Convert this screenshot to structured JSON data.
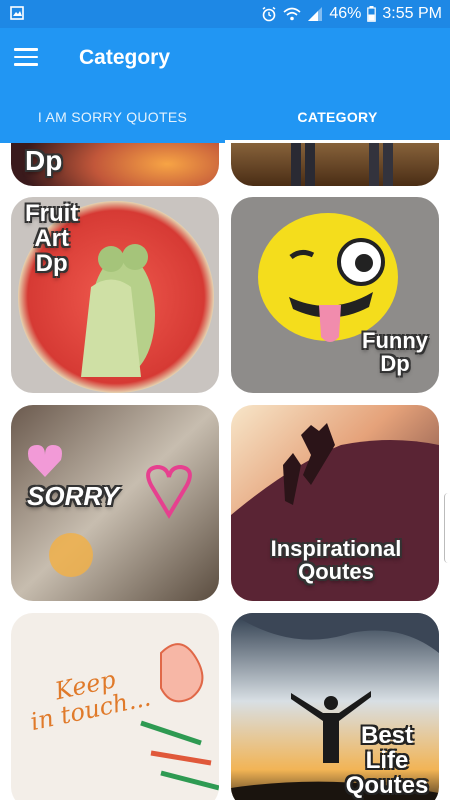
{
  "status_bar": {
    "battery_text": "46%",
    "time": "3:55 PM",
    "icons": [
      "image-icon",
      "alarm-icon",
      "wifi-icon",
      "signal-icon",
      "battery-icon"
    ]
  },
  "app_bar": {
    "title": "Category",
    "menu_icon": "hamburger-menu-icon"
  },
  "tabs": [
    {
      "label": "I AM SORRY QUOTES",
      "active": false
    },
    {
      "label": "CATEGORY",
      "active": true
    }
  ],
  "cards": [
    {
      "id": "partial-dp",
      "label": "Dp"
    },
    {
      "id": "partial-couple",
      "label": ""
    },
    {
      "id": "fruit-art-dp",
      "label": "Fruit\nArt\nDp"
    },
    {
      "id": "funny-dp",
      "label": "Funny\nDp"
    },
    {
      "id": "sorry",
      "label": "SORRY"
    },
    {
      "id": "inspirational-qoutes",
      "label": "Inspirational\nQoutes"
    },
    {
      "id": "keep-in-touch",
      "label": "Keep\nin touch..."
    },
    {
      "id": "best-life-qoutes",
      "label": "Best\nLife\nQoutes"
    }
  ],
  "colors": {
    "primary": "#2196f3",
    "status_bar": "#1e88e5"
  }
}
